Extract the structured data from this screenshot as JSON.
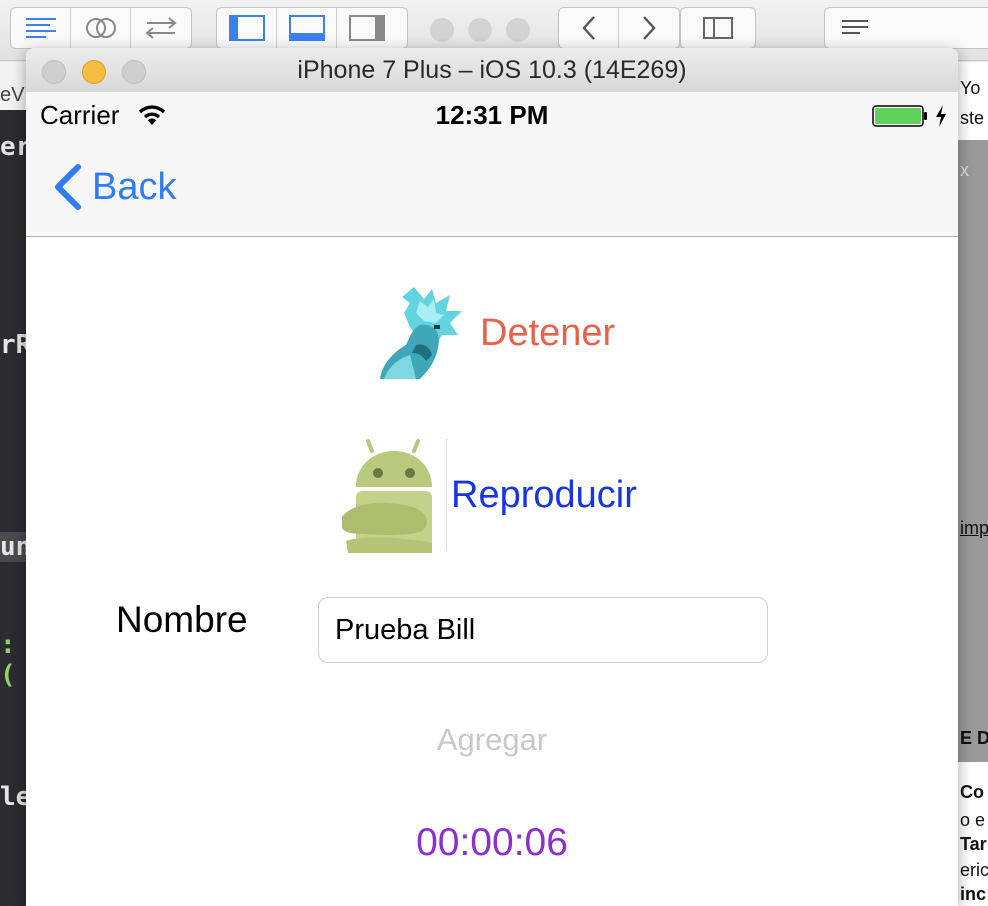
{
  "background": {
    "left_fragments": [
      "eV",
      "er",
      "rR",
      "un",
      ": (",
      "le"
    ],
    "right_fragments": [
      "Yo",
      "ste",
      "x",
      "imp",
      "E D",
      "Co",
      "o e",
      "Tar",
      "eric",
      "inc"
    ]
  },
  "simulator": {
    "title": "iPhone 7 Plus – iOS 10.3 (14E269)"
  },
  "status_bar": {
    "carrier": "Carrier",
    "time": "12:31 PM",
    "battery_color": "#5fd05a"
  },
  "nav": {
    "back_label": "Back"
  },
  "buttons": {
    "stop_label": "Detener",
    "play_label": "Reproducir",
    "add_label": "Agregar"
  },
  "form": {
    "name_label": "Nombre",
    "name_value": "Prueba Bill"
  },
  "timer": {
    "value": "00:00:06"
  },
  "colors": {
    "ios_blue": "#2f7cf6",
    "stop_red": "#e8624b",
    "play_blue": "#1536e0",
    "timer_purple": "#8c2fcc",
    "disabled_gray": "#c8c8c8"
  }
}
